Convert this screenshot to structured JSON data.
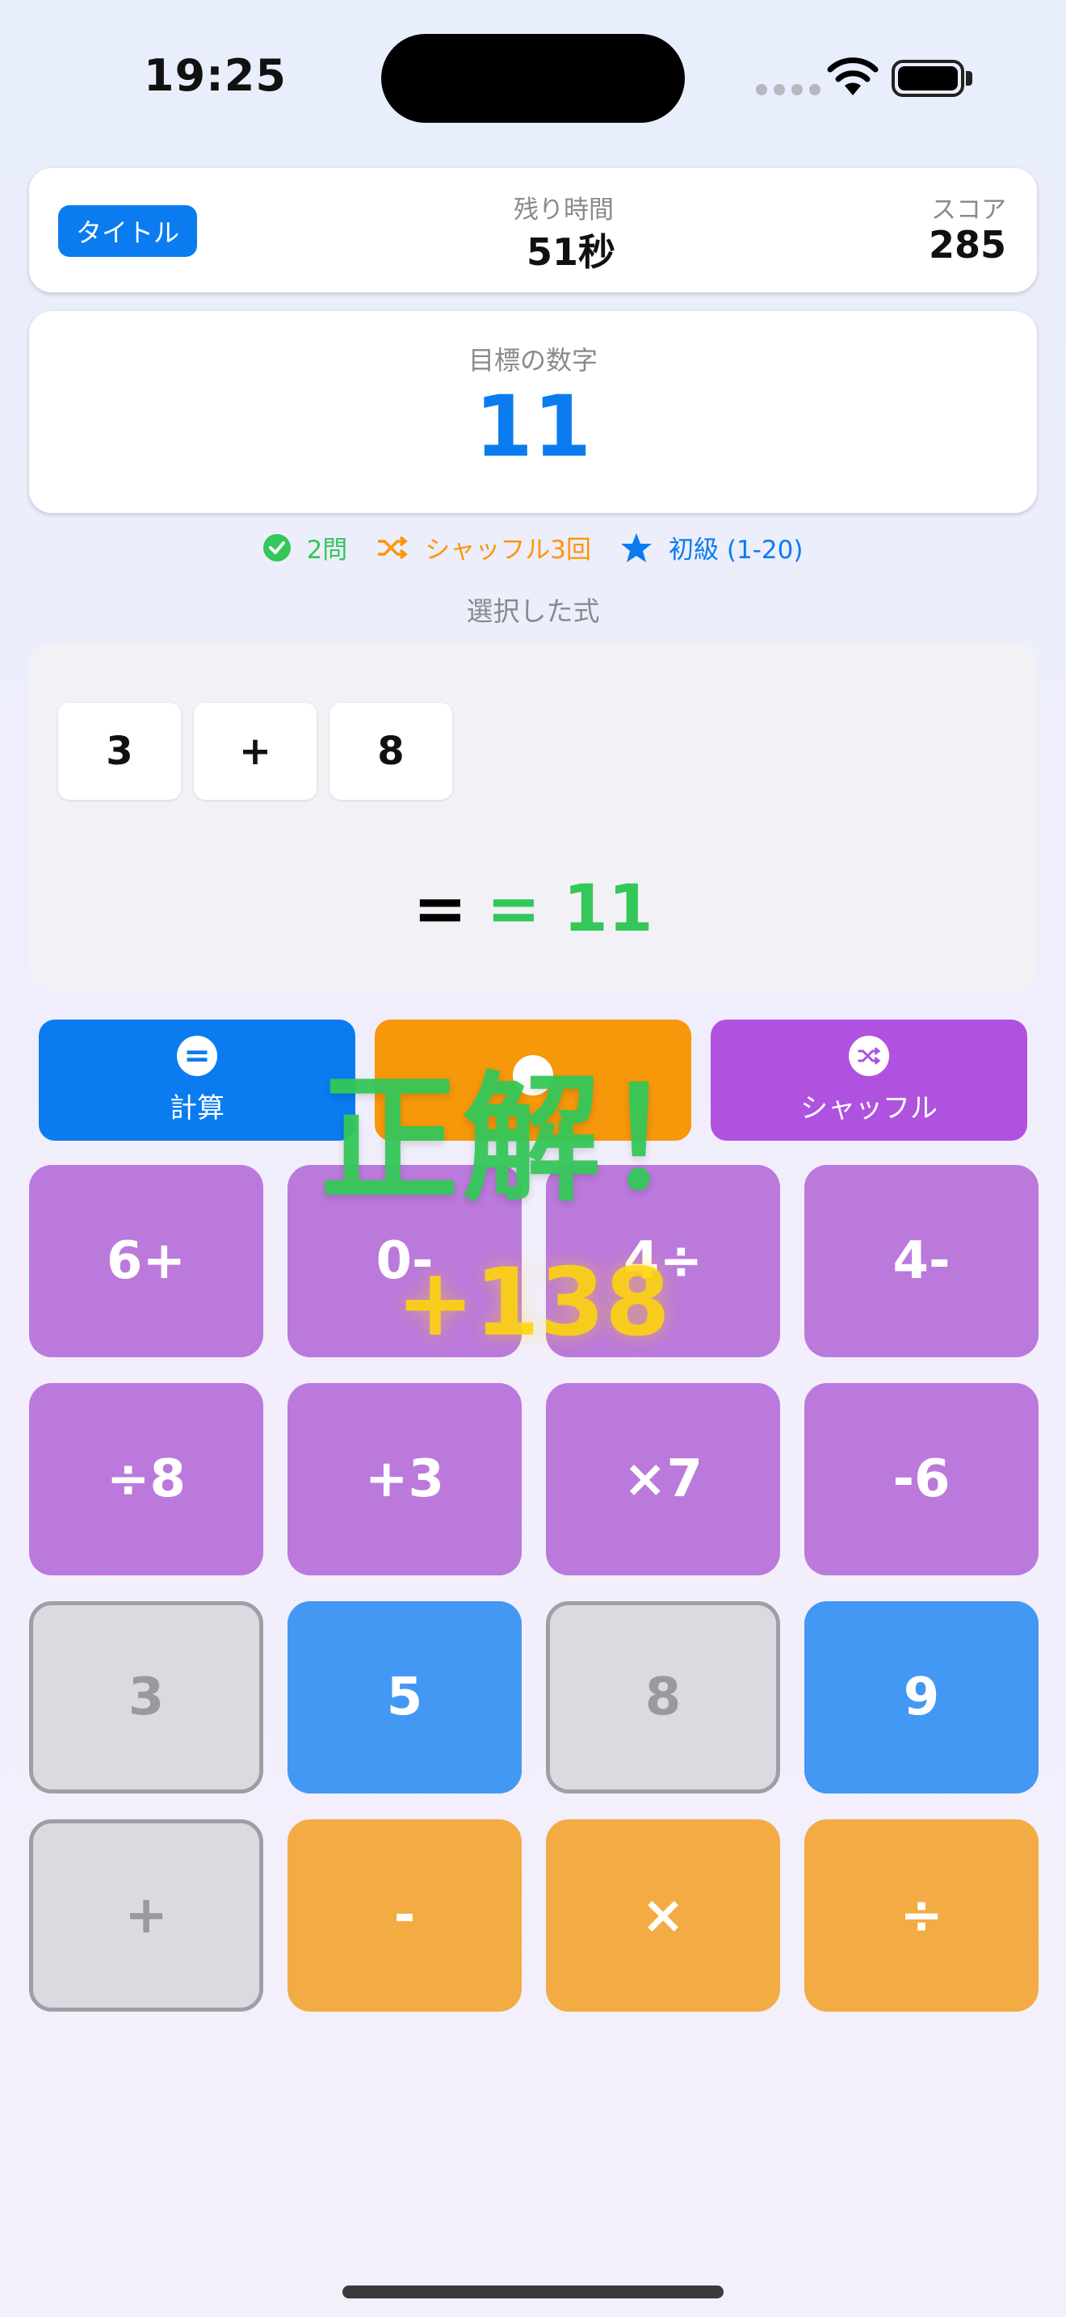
{
  "status_bar": {
    "time": "19:25"
  },
  "header": {
    "title_button": "タイトル",
    "time_label": "残り時間",
    "time_value": "51秒",
    "score_label": "スコア",
    "score_value": "285"
  },
  "target": {
    "label": "目標の数字",
    "value": "11"
  },
  "stats": {
    "solved": "2問",
    "shuffles": "シャッフル3回",
    "level": "初級 (1-20)"
  },
  "expression": {
    "section_title": "選択した式",
    "tiles": [
      "3",
      "+",
      "8"
    ],
    "equals_sign": "=",
    "result": "= 11"
  },
  "actions": {
    "calculate": "計算",
    "shuffle": "シャッフル"
  },
  "keypad": [
    [
      "6+",
      "0-",
      "4÷",
      "4-"
    ],
    [
      "÷8",
      "+3",
      "×7",
      "-6"
    ],
    [
      "3",
      "5",
      "8",
      "9"
    ],
    [
      "+",
      "-",
      "×",
      "÷"
    ]
  ],
  "overlay": {
    "message": "正解！",
    "points": "+138"
  },
  "colors": {
    "accent_blue": "#0a7cf0",
    "success_green": "#34c759",
    "warning_orange": "#ff9500",
    "purple": "#b052e0"
  }
}
